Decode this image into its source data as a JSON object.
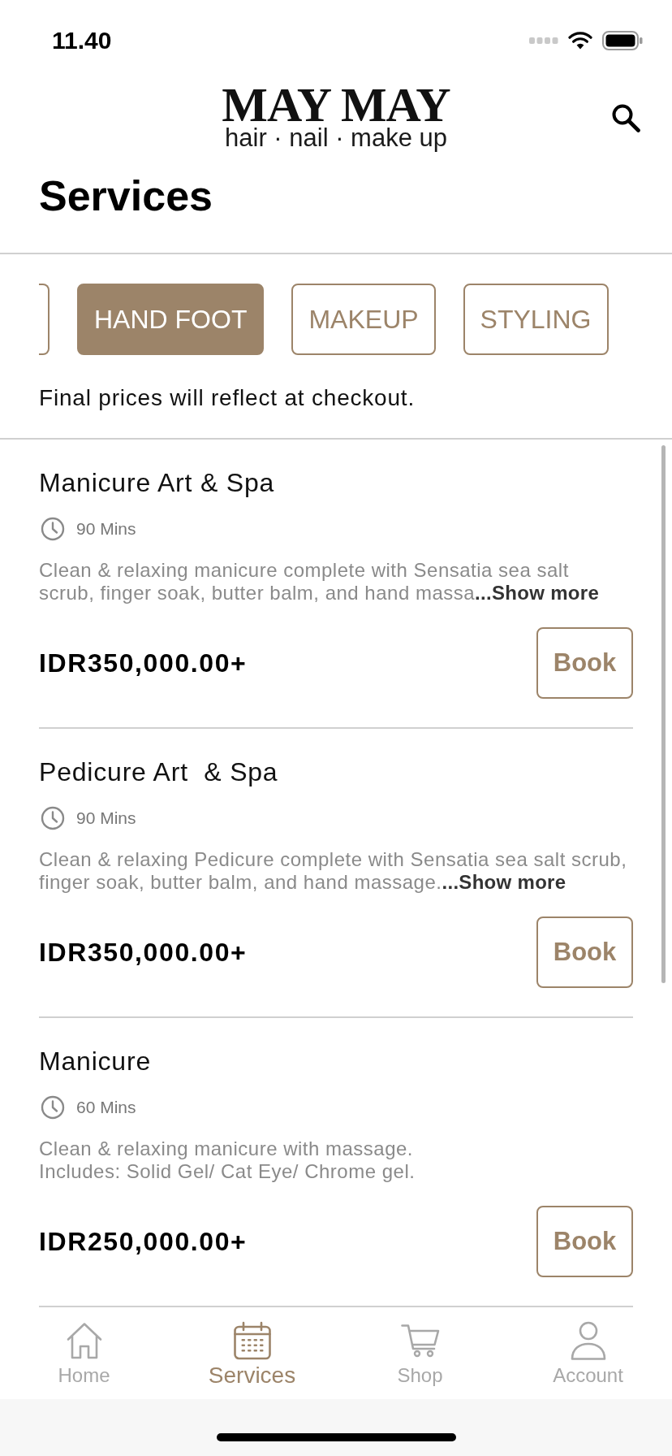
{
  "status_bar": {
    "time": "11.40"
  },
  "header": {
    "logo_name": "MAY MAY",
    "logo_tagline": "hair · nail · make up"
  },
  "title": "Services",
  "tabs": [
    {
      "kind": "partial",
      "selected": false
    },
    {
      "kind": "full",
      "label": "HAND FOOT",
      "selected": true
    },
    {
      "kind": "full",
      "label": "MAKEUP",
      "selected": false
    },
    {
      "kind": "full",
      "label": "STYLING",
      "selected": false
    }
  ],
  "notice": "Final prices will reflect at checkout.",
  "services": [
    {
      "name": "Manicure Art & Spa",
      "duration": "90 Mins",
      "description_lines": [
        "Clean & relaxing manicure complete with Sensatia sea salt",
        "scrub, finger soak, butter balm, and hand massa"
      ],
      "show_more": "...Show more",
      "price": "IDR350,000.00+",
      "button": "Book"
    },
    {
      "name": "Pedicure Art  & Spa",
      "duration": "90 Mins",
      "description_lines": [
        "Clean & relaxing Pedicure complete with Sensatia sea salt scrub,",
        "finger soak, butter balm, and hand massage."
      ],
      "show_more": "...Show more",
      "price": "IDR350,000.00+",
      "button": "Book"
    },
    {
      "name": "Manicure",
      "duration": "60 Mins",
      "description_lines": [
        "Clean & relaxing manicure with massage.",
        "Includes: Solid Gel/ Cat Eye/ Chrome gel."
      ],
      "price": "IDR250,000.00+",
      "button": "Book"
    }
  ],
  "bottom_nav": [
    {
      "label": "Home",
      "selected": false
    },
    {
      "label": "Services",
      "selected": true
    },
    {
      "label": "Shop",
      "selected": false
    },
    {
      "label": "Account",
      "selected": false
    }
  ]
}
